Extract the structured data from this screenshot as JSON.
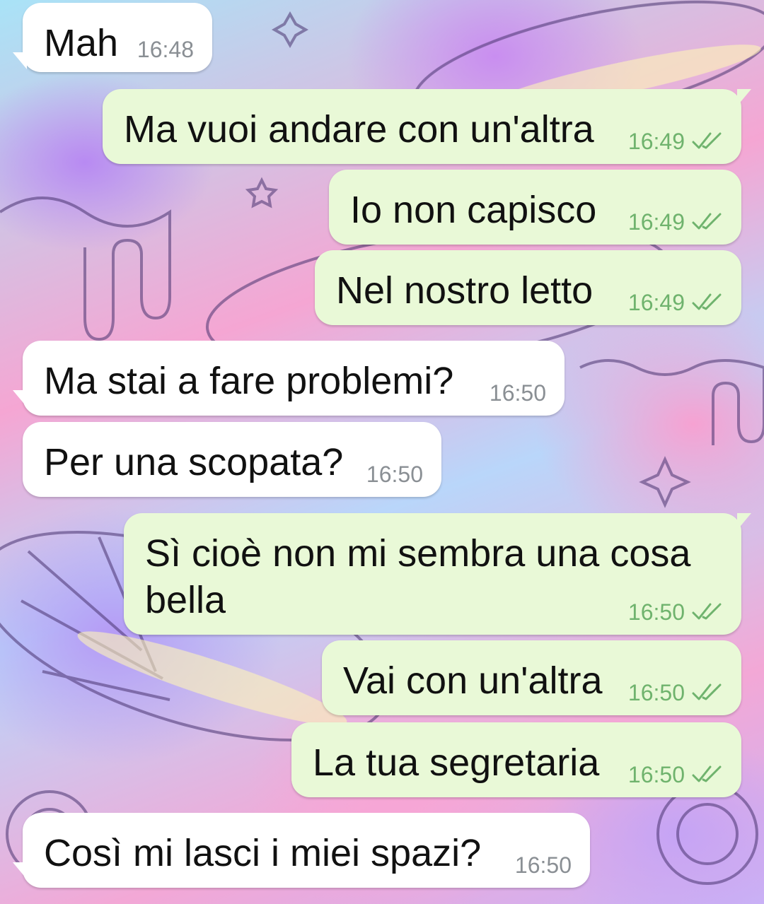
{
  "messages": [
    {
      "direction": "incoming",
      "text": "Mah",
      "time": "16:48"
    },
    {
      "direction": "outgoing",
      "text": "Ma vuoi andare con un'altra",
      "time": "16:49",
      "status": "read"
    },
    {
      "direction": "outgoing",
      "text": "Io non capisco",
      "time": "16:49",
      "status": "read"
    },
    {
      "direction": "outgoing",
      "text": "Nel nostro letto",
      "time": "16:49",
      "status": "read"
    },
    {
      "direction": "incoming",
      "text": "Ma stai a fare problemi?",
      "time": "16:50"
    },
    {
      "direction": "incoming",
      "text": "Per una scopata?",
      "time": "16:50"
    },
    {
      "direction": "outgoing",
      "text": "Sì cioè non mi sembra una cosa bella",
      "time": "16:50",
      "status": "read"
    },
    {
      "direction": "outgoing",
      "text": "Vai con un'altra",
      "time": "16:50",
      "status": "read"
    },
    {
      "direction": "outgoing",
      "text": "La tua segretaria",
      "time": "16:50",
      "status": "read"
    },
    {
      "direction": "incoming",
      "text": "Così mi lasci i miei spazi?",
      "time": "16:50"
    }
  ],
  "colors": {
    "incoming_bubble": "#ffffff",
    "outgoing_bubble": "#e9f9d7",
    "incoming_time": "#8a8f94",
    "outgoing_time": "#6fb36d",
    "read_ticks": "#6fb36d"
  },
  "icons": {
    "read_status": "double-check-icon"
  }
}
